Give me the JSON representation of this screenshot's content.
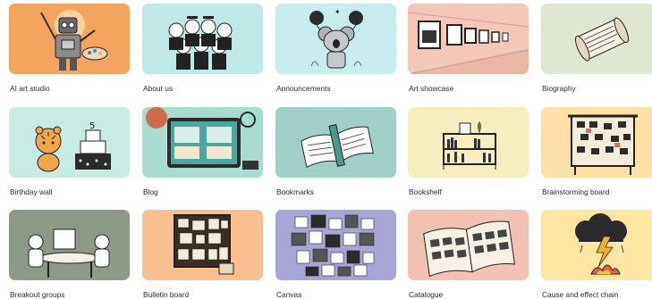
{
  "templates": [
    {
      "label": "AI art studio",
      "bg": "#f5a45e",
      "icon": "robot-painter-icon"
    },
    {
      "label": "About us",
      "bg": "#bfe8e6",
      "icon": "team-group-icon"
    },
    {
      "label": "Announcements",
      "bg": "#c9ecee",
      "icon": "koala-balloons-icon"
    },
    {
      "label": "Art showcase",
      "bg": "#f2c8b8",
      "icon": "gallery-wall-icon"
    },
    {
      "label": "Biography",
      "bg": "#dfe6d2",
      "icon": "scroll-icon"
    },
    {
      "label": "Birthday wall",
      "bg": "#c8ebe3",
      "icon": "tiger-cake-icon"
    },
    {
      "label": "Blog",
      "bg": "#a9dcd0",
      "icon": "tablet-desk-icon"
    },
    {
      "label": "Bookmarks",
      "bg": "#9fcfc7",
      "icon": "open-book-icon"
    },
    {
      "label": "Bookshelf",
      "bg": "#f6edbf",
      "icon": "bookshelf-icon"
    },
    {
      "label": "Brainstorming board",
      "bg": "#fde0a6",
      "icon": "pinboard-icon"
    },
    {
      "label": "Breakout groups",
      "bg": "#8e9a88",
      "icon": "group-table-icon"
    },
    {
      "label": "Bulletin board",
      "bg": "#f8c08f",
      "icon": "bulletin-board-icon"
    },
    {
      "label": "Canvas",
      "bg": "#a8a6d4",
      "icon": "collage-icon"
    },
    {
      "label": "Catalogue",
      "bg": "#f2c2b4",
      "icon": "catalogue-book-icon"
    },
    {
      "label": "Cause and effect chain",
      "bg": "#fde6a0",
      "icon": "storm-fire-icon"
    }
  ]
}
